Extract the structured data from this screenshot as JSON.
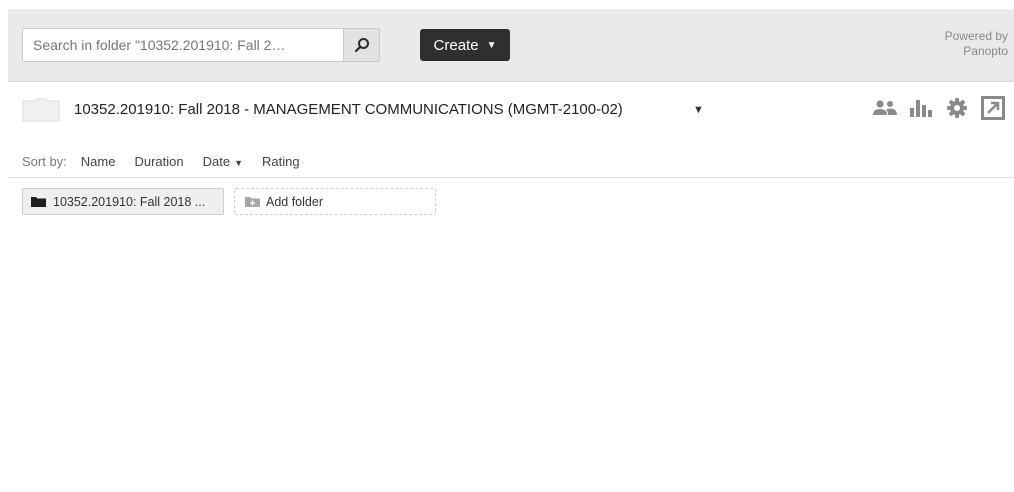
{
  "search": {
    "placeholder": "Search in folder \"10352.201910: Fall 2…",
    "button_icon": "search-icon"
  },
  "create": {
    "label": "Create",
    "caret": "▼"
  },
  "powered_by": {
    "line1": "Powered by",
    "line2": "Panopto"
  },
  "folder": {
    "title": "10352.201910: Fall 2018 - MANAGEMENT COMMUNICATIONS (MGMT-2100-02)",
    "caret": "▼",
    "icons": [
      "share-users-icon",
      "stats-bar-chart-icon",
      "settings-gear-icon",
      "open-external-icon"
    ]
  },
  "sort": {
    "label": "Sort by:",
    "options": [
      "Name",
      "Duration",
      "Date",
      "Rating"
    ],
    "active_caret": "▼"
  },
  "chips": {
    "current_folder": "10352.201910: Fall 2018 ...",
    "add_folder": "Add folder"
  },
  "colors": {
    "topbar_bg": "#eaeaea",
    "create_bg": "#2f2f2f",
    "icon_gray": "#8a8a8a"
  }
}
